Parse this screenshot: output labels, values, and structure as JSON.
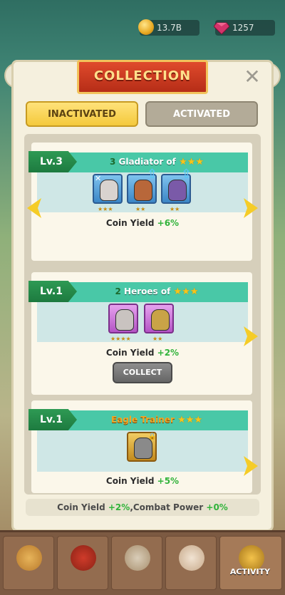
{
  "resources": {
    "coins": "13.7B",
    "gems": "1257"
  },
  "panel": {
    "title": "COLLECTION"
  },
  "tabs": [
    {
      "label": "INACTIVATED",
      "active": true
    },
    {
      "label": "ACTIVATED",
      "active": false
    }
  ],
  "cards": [
    {
      "level": "Lv.3",
      "title_number": "3",
      "title_text": "Gladiator of",
      "stars": "★★★",
      "heroes": [
        {
          "frame": "blue",
          "stars": "★★★"
        },
        {
          "frame": "blue",
          "stars": "★★"
        },
        {
          "frame": "blue",
          "stars": "★★"
        }
      ],
      "yield_label": "Coin Yield",
      "yield_value": "+6%"
    },
    {
      "level": "Lv.1",
      "title_number": "2",
      "title_text": "Heroes of",
      "stars": "★★★",
      "heroes": [
        {
          "frame": "purple",
          "stars": "★★★★"
        },
        {
          "frame": "purple",
          "stars": "★★"
        }
      ],
      "yield_label": "Coin Yield",
      "yield_value": "+2%",
      "button": "COLLECT"
    },
    {
      "level": "Lv.1",
      "title_number": "",
      "title_text": "Eagle Trainer",
      "stars": "★★★",
      "heroes": [
        {
          "frame": "gold",
          "stars": ""
        }
      ],
      "yield_label": "Coin Yield",
      "yield_value": "+5%"
    }
  ],
  "bonus": {
    "coin_label": "Coin Yield ",
    "coin_value": "+2%",
    "combat_label": ",Combat Power ",
    "combat_value": "+0%"
  },
  "nav": {
    "active_label": "ACTIVITY"
  },
  "colors": {
    "accent_green": "#31b33b",
    "header_teal": "#49c8a7",
    "ribbon_red": "#c2351c",
    "tab_yellow": "#f4c93c"
  }
}
